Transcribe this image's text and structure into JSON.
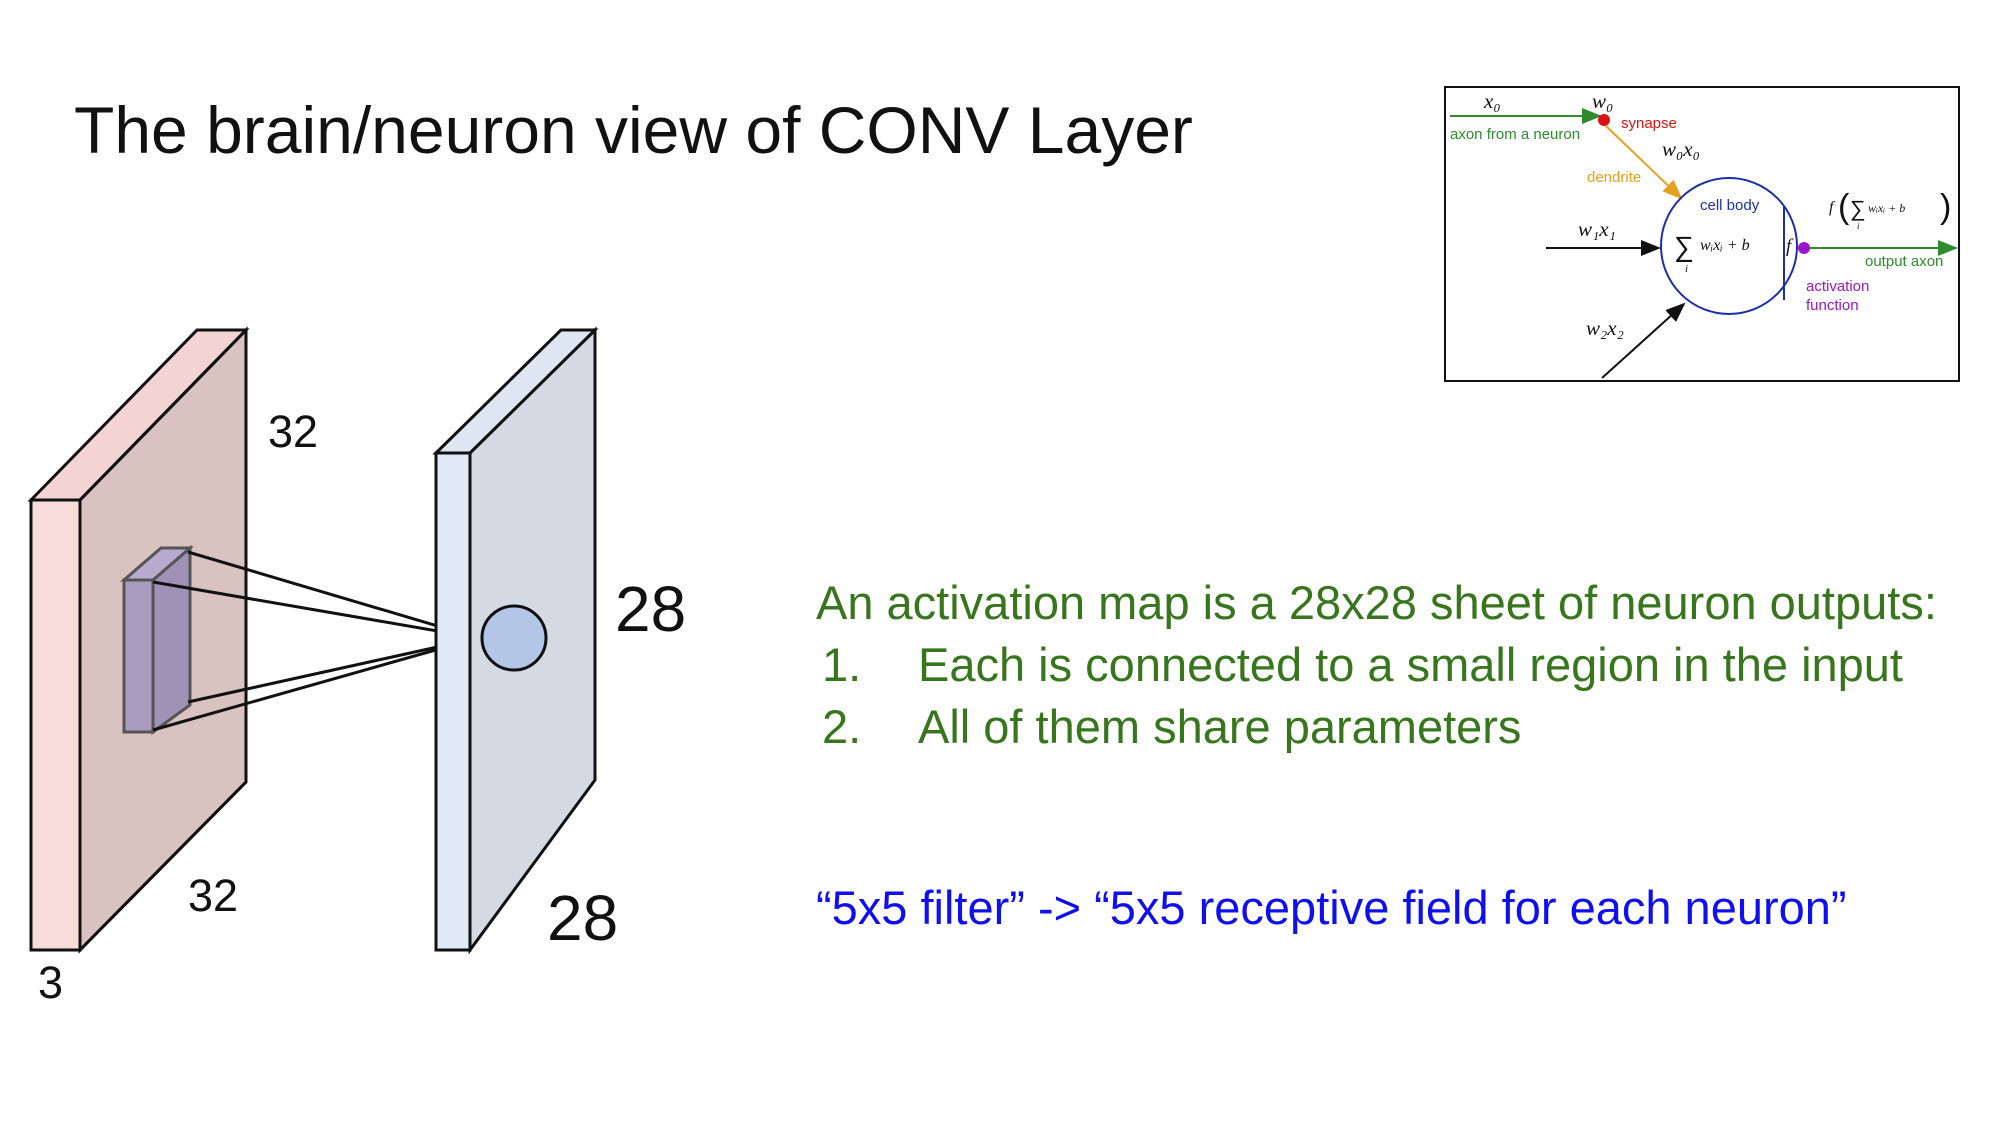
{
  "slide": {
    "title": "The brain/neuron view of CONV Layer"
  },
  "volume_diagram": {
    "input_height_label": "32",
    "input_width_label": "32",
    "input_depth_label": "3",
    "output_height_label": "28",
    "output_width_label": "28",
    "colors": {
      "input_front": "#f8dcda",
      "input_face": "#d9c3c1",
      "filter": "#a99cbf",
      "output_front": "#e0eaf6",
      "output_face": "#d3dae4",
      "neuron": "#b3c6e7"
    }
  },
  "neuron_diagram": {
    "x0": "x₀",
    "w0": "w₀",
    "synapse": "synapse",
    "axon_from_neuron": "axon from a neuron",
    "w0x0": "w₀x₀",
    "dendrite": "dendrite",
    "cell_body": "cell body",
    "w1x1": "w₁x₁",
    "sum_symbol": "∑",
    "sum_index": "i",
    "sum_expr": "wᵢxᵢ + b",
    "f": "f",
    "output_expr_f": "f",
    "output_expr": "wᵢxᵢ + b",
    "output_axon": "output axon",
    "activation": "activation",
    "function": "function",
    "w2x2": "w₂x₂",
    "colors": {
      "synapse": "#dd1111",
      "axon": "#2e8b2e",
      "dendrite": "#e6a020",
      "cell_body": "#1c2fa8",
      "activation": "#9b16c9"
    }
  },
  "description": {
    "intro": "An activation map is a 28x28 sheet of neuron outputs:",
    "items": [
      {
        "num": "1.",
        "text": "Each is connected to a small region in the input"
      },
      {
        "num": "2.",
        "text": "All of them share parameters"
      }
    ],
    "quote": "“5x5 filter” -> “5x5 receptive field for each neuron”"
  }
}
